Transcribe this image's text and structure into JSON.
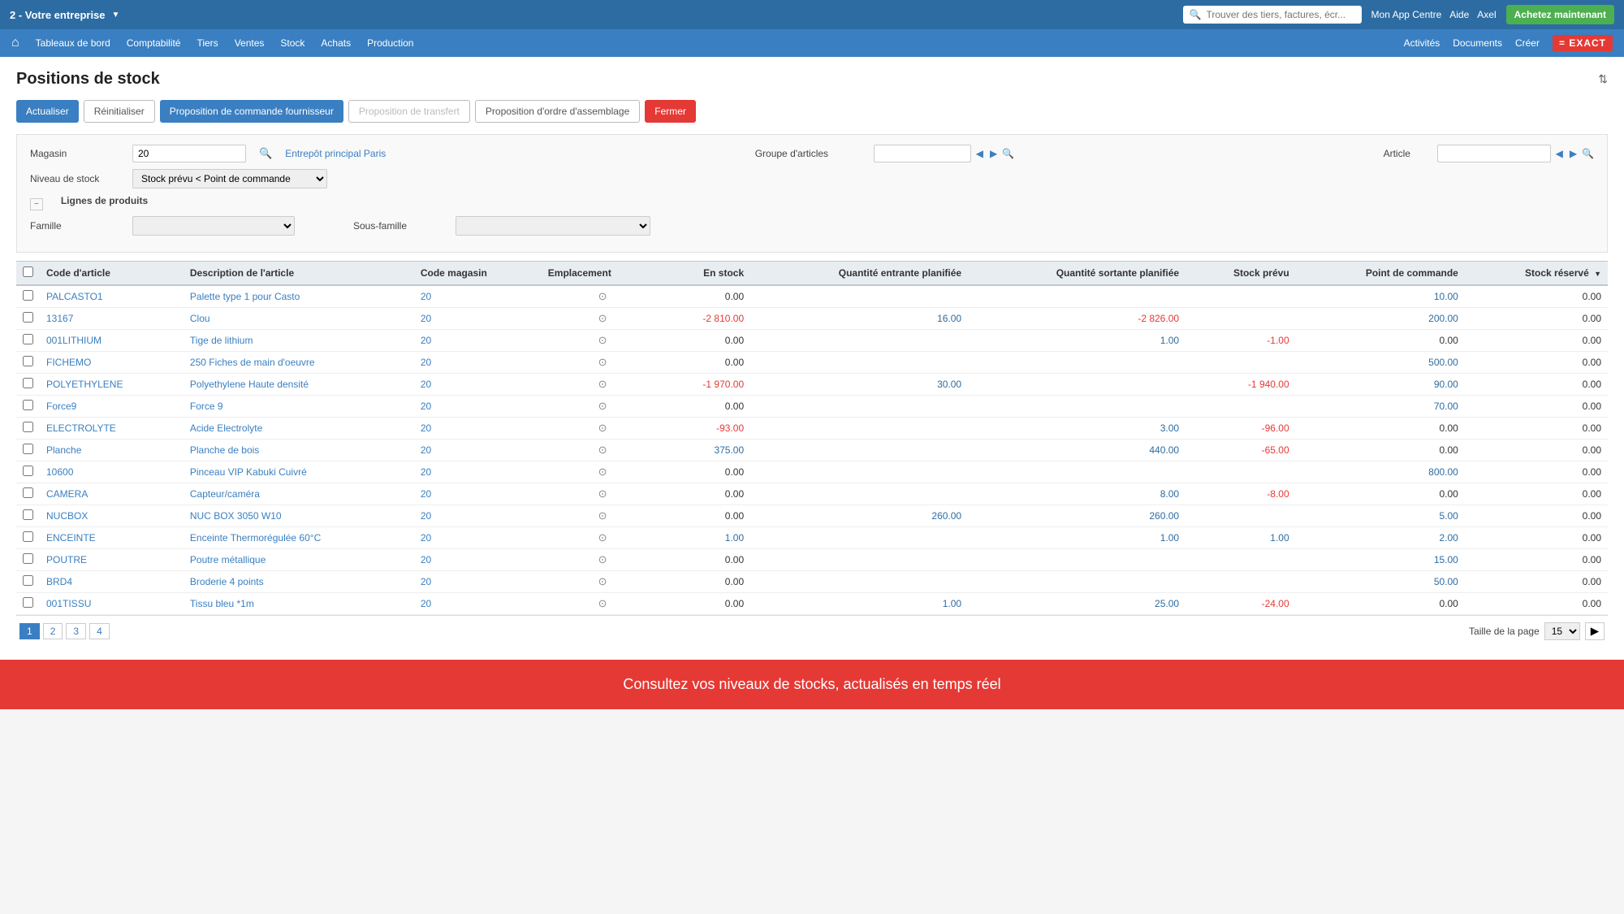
{
  "app": {
    "company": "2 - Votre entreprise",
    "search_placeholder": "Trouver des tiers, factures, écr...",
    "nav_links": [
      "Mon App Centre",
      "Aide",
      "Axel"
    ],
    "cta_button": "Achetez maintenant",
    "exact_logo": "= EXACT"
  },
  "nav": {
    "home_icon": "⌂",
    "items": [
      "Tableaux de bord",
      "Comptabilité",
      "Tiers",
      "Ventes",
      "Stock",
      "Achats",
      "Production"
    ],
    "right_items": [
      "Activités",
      "Documents",
      "Créer"
    ]
  },
  "page": {
    "title": "Positions de stock",
    "sort_icon": "⇅"
  },
  "toolbar": {
    "actualiser": "Actualiser",
    "reinitialiser": "Réinitialiser",
    "proposition_commande": "Proposition de commande fournisseur",
    "proposition_transfert": "Proposition de transfert",
    "proposition_ordre": "Proposition d'ordre d'assemblage",
    "fermer": "Fermer"
  },
  "filters": {
    "magasin_label": "Magasin",
    "magasin_value": "20",
    "magasin_link": "Entrepôt principal Paris",
    "niveau_stock_label": "Niveau de stock",
    "niveau_stock_value": "Stock prévu < Point de commande",
    "groupe_articles_label": "Groupe d'articles",
    "article_label": "Article",
    "lignes_produits_label": "Lignes de produits",
    "famille_label": "Famille",
    "sous_famille_label": "Sous-famille"
  },
  "table": {
    "columns": [
      "Code d'article",
      "Description de l'article",
      "Code magasin",
      "Emplacement",
      "En stock",
      "Quantité entrante planifiée",
      "Quantité sortante planifiée",
      "Stock prévu",
      "Point de commande",
      "Stock réservé"
    ],
    "rows": [
      {
        "code": "PALCASTO1",
        "description": "Palette type 1 pour Casto",
        "code_magasin": "20",
        "en_stock": "0.00",
        "qte_entrante": "",
        "qte_sortante": "",
        "stock_prevu": "",
        "point_commande": "10.00",
        "stock_reserve": "0.00"
      },
      {
        "code": "13167",
        "description": "Clou",
        "code_magasin": "20",
        "en_stock": "-2 810.00",
        "qte_entrante": "16.00",
        "qte_sortante": "-2 826.00",
        "stock_prevu": "",
        "point_commande": "200.00",
        "stock_reserve": "0.00"
      },
      {
        "code": "001LITHIUM",
        "description": "Tige de lithium",
        "code_magasin": "20",
        "en_stock": "0.00",
        "qte_entrante": "",
        "qte_sortante": "1.00",
        "stock_prevu": "-1.00",
        "point_commande": "0.00",
        "stock_reserve": "0.00"
      },
      {
        "code": "FICHEMO",
        "description": "250 Fiches de main d'oeuvre",
        "code_magasin": "20",
        "en_stock": "0.00",
        "qte_entrante": "",
        "qte_sortante": "",
        "stock_prevu": "",
        "point_commande": "500.00",
        "stock_reserve": "0.00"
      },
      {
        "code": "POLYETHYLENE",
        "description": "Polyethylene Haute densité",
        "code_magasin": "20",
        "en_stock": "-1 970.00",
        "qte_entrante": "30.00",
        "qte_sortante": "",
        "stock_prevu": "-1 940.00",
        "point_commande": "90.00",
        "stock_reserve": "0.00"
      },
      {
        "code": "Force9",
        "description": "Force 9",
        "code_magasin": "20",
        "en_stock": "0.00",
        "qte_entrante": "",
        "qte_sortante": "",
        "stock_prevu": "",
        "point_commande": "70.00",
        "stock_reserve": "0.00"
      },
      {
        "code": "ELECTROLYTE",
        "description": "Acide Electrolyte",
        "code_magasin": "20",
        "en_stock": "-93.00",
        "qte_entrante": "",
        "qte_sortante": "3.00",
        "stock_prevu": "-96.00",
        "point_commande": "0.00",
        "stock_reserve": "0.00"
      },
      {
        "code": "Planche",
        "description": "Planche de bois",
        "code_magasin": "20",
        "en_stock": "375.00",
        "qte_entrante": "",
        "qte_sortante": "440.00",
        "stock_prevu": "-65.00",
        "point_commande": "0.00",
        "stock_reserve": "0.00"
      },
      {
        "code": "10600",
        "description": "Pinceau VIP Kabuki Cuivré",
        "code_magasin": "20",
        "en_stock": "0.00",
        "qte_entrante": "",
        "qte_sortante": "",
        "stock_prevu": "",
        "point_commande": "800.00",
        "stock_reserve": "0.00"
      },
      {
        "code": "CAMERA",
        "description": "Capteur/caméra",
        "code_magasin": "20",
        "en_stock": "0.00",
        "qte_entrante": "",
        "qte_sortante": "8.00",
        "stock_prevu": "-8.00",
        "point_commande": "0.00",
        "stock_reserve": "0.00"
      },
      {
        "code": "NUCBOX",
        "description": "NUC BOX 3050 W10",
        "code_magasin": "20",
        "en_stock": "0.00",
        "qte_entrante": "260.00",
        "qte_sortante": "260.00",
        "stock_prevu": "",
        "point_commande": "5.00",
        "stock_reserve": "0.00"
      },
      {
        "code": "ENCEINTE",
        "description": "Enceinte Thermorégulée 60°C",
        "code_magasin": "20",
        "en_stock": "1.00",
        "qte_entrante": "",
        "qte_sortante": "1.00",
        "stock_prevu": "1.00",
        "point_commande": "2.00",
        "stock_reserve": "0.00"
      },
      {
        "code": "POUTRE",
        "description": "Poutre métallique",
        "code_magasin": "20",
        "en_stock": "0.00",
        "qte_entrante": "",
        "qte_sortante": "",
        "stock_prevu": "",
        "point_commande": "15.00",
        "stock_reserve": "0.00"
      },
      {
        "code": "BRD4",
        "description": "Broderie 4 points",
        "code_magasin": "20",
        "en_stock": "0.00",
        "qte_entrante": "",
        "qte_sortante": "",
        "stock_prevu": "",
        "point_commande": "50.00",
        "stock_reserve": "0.00"
      },
      {
        "code": "001TISSU",
        "description": "Tissu bleu *1m",
        "code_magasin": "20",
        "en_stock": "0.00",
        "qte_entrante": "1.00",
        "qte_sortante": "25.00",
        "stock_prevu": "-24.00",
        "point_commande": "0.00",
        "stock_reserve": "0.00"
      }
    ]
  },
  "pagination": {
    "pages": [
      "1",
      "2",
      "3",
      "4"
    ],
    "active_page": "1",
    "taille_label": "Taille de la page",
    "page_size": "15",
    "next_icon": "▶"
  },
  "banner": {
    "text": "Consultez vos niveaux de stocks, actualisés en temps réel"
  }
}
